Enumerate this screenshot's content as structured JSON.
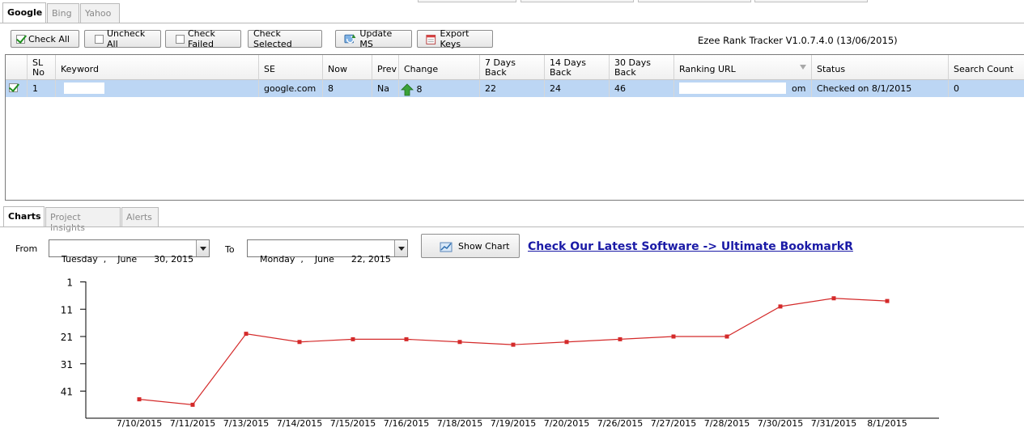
{
  "engine_tabs": [
    "Google",
    "Bing",
    "Yahoo"
  ],
  "toolbar": {
    "check_all": "Check All",
    "uncheck_all": "Uncheck All",
    "check_failed": "Check Failed",
    "check_selected": "Check Selected",
    "update_ms": "Update MS",
    "export_keys": "Export Keys"
  },
  "app_title": "Ezee Rank Tracker V1.0.7.4.0 (13/06/2015)",
  "grid": {
    "columns": [
      "SL No",
      "Keyword",
      "SE",
      "Now",
      "Prev",
      "Change",
      "7 Days Back",
      "14 Days Back",
      "30 Days Back",
      "Ranking URL",
      "Status",
      "Search Count"
    ],
    "rows": [
      {
        "checked": true,
        "sl_no": "1",
        "keyword": "",
        "se": "google.com",
        "now": "8",
        "prev": "Na",
        "change": "8",
        "d7": "22",
        "d14": "24",
        "d30": "46",
        "ranking_url_suffix": "om",
        "status": "Checked on 8/1/2015",
        "search_count": "0"
      }
    ]
  },
  "bottom_tabs": [
    "Charts",
    "Project Insights",
    "Alerts"
  ],
  "filters": {
    "from_label": "From",
    "to_label": "To",
    "from_date": "Tuesday  ,    June      30, 2015",
    "to_date": "Monday  ,    June      22, 2015",
    "show_chart": "Show Chart"
  },
  "promo_link": "Check Our Latest Software -> Ultimate BookmarkR",
  "colors": {
    "series": "#d42a2a",
    "selected_row": "#bcd6f4",
    "link": "#1a1aa6"
  },
  "chart_data": {
    "type": "line",
    "x": [
      "7/10/2015",
      "7/11/2015",
      "7/13/2015",
      "7/14/2015",
      "7/15/2015",
      "7/16/2015",
      "7/18/2015",
      "7/19/2015",
      "7/20/2015",
      "7/26/2015",
      "7/27/2015",
      "7/28/2015",
      "7/30/2015",
      "7/31/2015",
      "8/1/2015"
    ],
    "series": [
      {
        "values": [
          44,
          46,
          20,
          23,
          22,
          22,
          23,
          24,
          23,
          22,
          21,
          21,
          10,
          7,
          8
        ]
      }
    ],
    "yticks": [
      1,
      11,
      21,
      31,
      41
    ],
    "ylim": [
      1,
      51
    ],
    "y_inverted": true,
    "grid": false,
    "legend": "none"
  }
}
